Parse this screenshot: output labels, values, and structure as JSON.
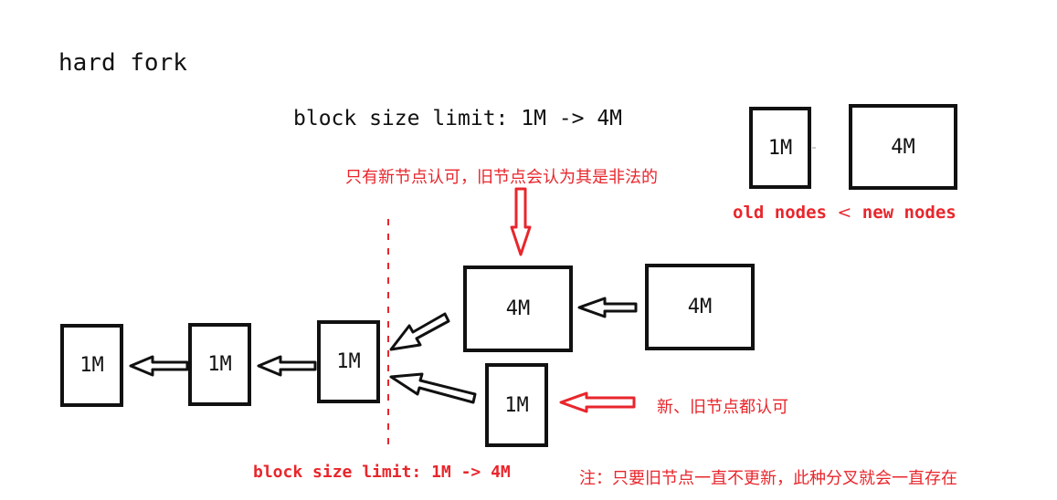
{
  "title": "hard fork",
  "subtitle": "block size limit: 1M -> 4M",
  "colors": {
    "red": "#e8262c",
    "ink": "#111111"
  },
  "legend": {
    "old_block": "1M",
    "new_block": "4M",
    "caption_old": "old nodes",
    "caption_sep": "<",
    "caption_new": "new nodes"
  },
  "annotations": {
    "top_note": "只有新节点认可，旧节点会认为其是非法的",
    "right_note": "新、旧节点都认可",
    "bottom_note": "注：只要旧节点一直不更新，此种分叉就会一直存在",
    "fork_line_label": "block size limit: 1M -> 4M"
  },
  "chain": {
    "main": [
      "1M",
      "1M",
      "1M"
    ],
    "new_branch": [
      "4M",
      "4M"
    ],
    "old_branch": [
      "1M"
    ]
  }
}
